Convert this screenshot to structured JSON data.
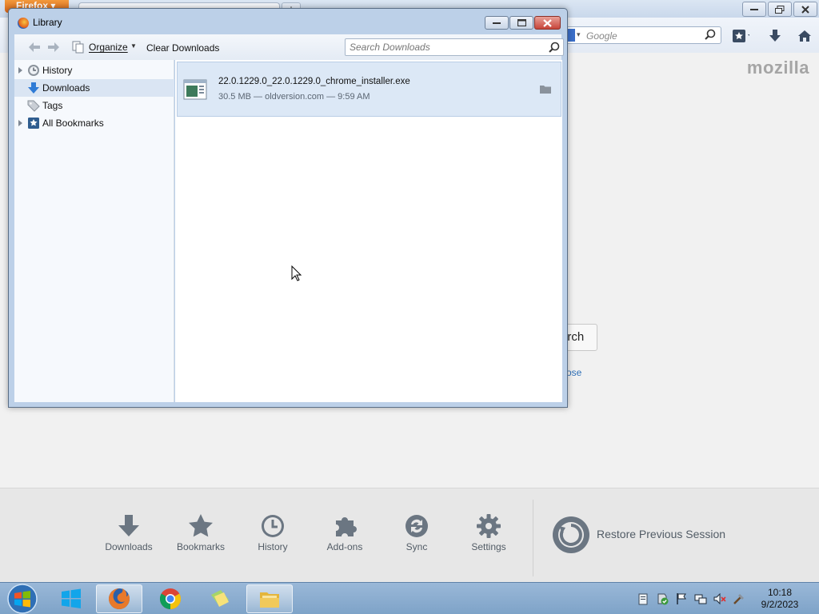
{
  "firefox": {
    "app_button_label": "Firefox",
    "new_tab_label": "+",
    "search_placeholder": "Google",
    "brand": "mozilla",
    "search_button_fragment": "arch",
    "link_fragment": "ose"
  },
  "launcher": {
    "items": [
      {
        "label": "Downloads",
        "icon": "download-icon"
      },
      {
        "label": "Bookmarks",
        "icon": "star-icon"
      },
      {
        "label": "History",
        "icon": "clock-icon"
      },
      {
        "label": "Add-ons",
        "icon": "puzzle-icon"
      },
      {
        "label": "Sync",
        "icon": "sync-icon"
      },
      {
        "label": "Settings",
        "icon": "gear-icon"
      }
    ],
    "restore_label": "Restore Previous Session"
  },
  "library": {
    "title": "Library",
    "toolbar": {
      "organize_label": "Organize",
      "clear_label": "Clear Downloads",
      "search_placeholder": "Search Downloads"
    },
    "sidebar": [
      {
        "label": "History",
        "expandable": true,
        "selected": false
      },
      {
        "label": "Downloads",
        "expandable": false,
        "selected": true
      },
      {
        "label": "Tags",
        "expandable": false,
        "selected": false
      },
      {
        "label": "All Bookmarks",
        "expandable": true,
        "selected": false
      }
    ],
    "downloads": [
      {
        "name": "22.0.1229.0_22.0.1229.0_chrome_installer.exe",
        "meta": "30.5 MB — oldversion.com — 9:59 AM"
      }
    ]
  },
  "taskbar": {
    "apps": [
      "windows-store",
      "firefox",
      "chrome",
      "notes",
      "file-explorer"
    ],
    "clock": {
      "time": "10:18",
      "date": "9/2/2023"
    }
  },
  "colors": {
    "accent_orange": "#e8792a",
    "selection_blue": "#dce8f6",
    "taskbar": "#8cadd0"
  }
}
